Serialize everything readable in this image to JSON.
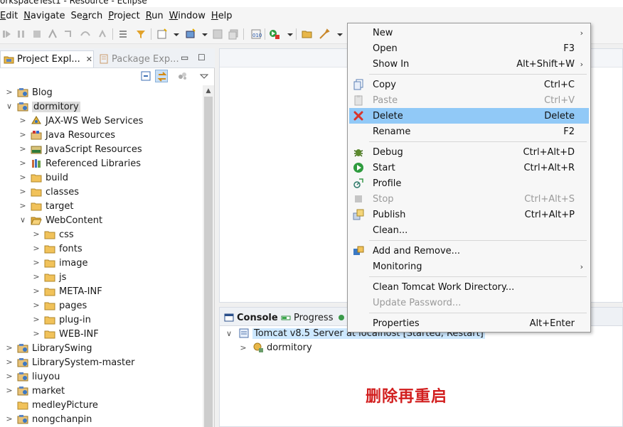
{
  "window": {
    "title": "orkspaceTest1 - Resource - Eclipse"
  },
  "menubar": [
    {
      "label": "Edit",
      "mnemonic": "E"
    },
    {
      "label": "Navigate",
      "mnemonic": "N"
    },
    {
      "label": "Search",
      "mnemonic": "a"
    },
    {
      "label": "Project",
      "mnemonic": "P"
    },
    {
      "label": "Run",
      "mnemonic": "R"
    },
    {
      "label": "Window",
      "mnemonic": "W"
    },
    {
      "label": "Help",
      "mnemonic": "H"
    }
  ],
  "left_tabs": {
    "project_explorer": {
      "label": "Project Expl...",
      "close": "✕"
    },
    "package_explorer": {
      "label": "Package Exp..."
    },
    "minimize": "▭",
    "maximize": "☐"
  },
  "tree": [
    {
      "label": "Blog",
      "icon": "project-icon",
      "expanded": false
    },
    {
      "label": "dormitory",
      "icon": "project-icon",
      "expanded": true,
      "selected": true
    },
    {
      "label": "JAX-WS Web Services",
      "icon": "webservice-icon",
      "expanded": false
    },
    {
      "label": "Java Resources",
      "icon": "java-resources-icon",
      "expanded": false
    },
    {
      "label": "JavaScript Resources",
      "icon": "js-resources-icon",
      "expanded": false
    },
    {
      "label": "Referenced Libraries",
      "icon": "library-icon",
      "expanded": false
    },
    {
      "label": "build",
      "icon": "folder-icon",
      "expanded": false
    },
    {
      "label": "classes",
      "icon": "folder-icon",
      "expanded": false
    },
    {
      "label": "target",
      "icon": "folder-icon",
      "expanded": false
    },
    {
      "label": "WebContent",
      "icon": "folder-open-icon",
      "expanded": true
    },
    {
      "label": "css",
      "icon": "folder-icon",
      "expanded": false
    },
    {
      "label": "fonts",
      "icon": "folder-icon",
      "expanded": false
    },
    {
      "label": "image",
      "icon": "folder-icon",
      "expanded": false
    },
    {
      "label": "js",
      "icon": "folder-icon",
      "expanded": false
    },
    {
      "label": "META-INF",
      "icon": "folder-icon",
      "expanded": false
    },
    {
      "label": "pages",
      "icon": "folder-icon",
      "expanded": false
    },
    {
      "label": "plug-in",
      "icon": "folder-icon",
      "expanded": false
    },
    {
      "label": "WEB-INF",
      "icon": "folder-icon",
      "expanded": false
    },
    {
      "label": "LibrarySwing",
      "icon": "project-icon",
      "expanded": false
    },
    {
      "label": "LibrarySystem-master",
      "icon": "project-icon",
      "expanded": false
    },
    {
      "label": "liuyou",
      "icon": "project-icon",
      "expanded": false
    },
    {
      "label": "market",
      "icon": "project-icon",
      "expanded": false
    },
    {
      "label": "medleyPicture",
      "icon": "folder-icon",
      "expanded": null
    },
    {
      "label": "nongchanpin",
      "icon": "project-icon",
      "expanded": false
    }
  ],
  "console": {
    "tabs": [
      {
        "label": "Console",
        "icon": "console-icon"
      },
      {
        "label": "Progress",
        "icon": "progress-icon"
      }
    ],
    "server": {
      "label": "Tomcat v8.5 Server at localhost  [Started, Restart]"
    },
    "module": {
      "label": "dormitory"
    }
  },
  "annotation": "删除再重启",
  "context_menu": {
    "items": [
      {
        "label": "New",
        "shortcut": "",
        "submenu": true,
        "icon": "",
        "disabled": false
      },
      {
        "label": "Open",
        "shortcut": "F3",
        "submenu": false,
        "icon": "",
        "disabled": false
      },
      {
        "label": "Show In",
        "shortcut": "Alt+Shift+W",
        "submenu": true,
        "icon": "",
        "disabled": false
      },
      {
        "label": "Copy",
        "shortcut": "Ctrl+C",
        "submenu": false,
        "icon": "copy-icon",
        "disabled": false
      },
      {
        "label": "Paste",
        "shortcut": "Ctrl+V",
        "submenu": false,
        "icon": "paste-icon",
        "disabled": true
      },
      {
        "label": "Delete",
        "shortcut": "Delete",
        "submenu": false,
        "icon": "delete-icon",
        "disabled": false,
        "hover": true
      },
      {
        "label": "Rename",
        "shortcut": "F2",
        "submenu": false,
        "icon": "",
        "disabled": false
      },
      {
        "label": "Debug",
        "shortcut": "Ctrl+Alt+D",
        "submenu": false,
        "icon": "debug-icon",
        "disabled": false
      },
      {
        "label": "Start",
        "shortcut": "Ctrl+Alt+R",
        "submenu": false,
        "icon": "start-icon",
        "disabled": false
      },
      {
        "label": "Profile",
        "shortcut": "",
        "submenu": false,
        "icon": "profile-icon",
        "disabled": false
      },
      {
        "label": "Stop",
        "shortcut": "Ctrl+Alt+S",
        "submenu": false,
        "icon": "stop-icon",
        "disabled": true
      },
      {
        "label": "Publish",
        "shortcut": "Ctrl+Alt+P",
        "submenu": false,
        "icon": "publish-icon",
        "disabled": false
      },
      {
        "label": "Clean...",
        "shortcut": "",
        "submenu": false,
        "icon": "",
        "disabled": false
      },
      {
        "label": "Add and Remove...",
        "shortcut": "",
        "submenu": false,
        "icon": "add-remove-icon",
        "disabled": false
      },
      {
        "label": "Monitoring",
        "shortcut": "",
        "submenu": true,
        "icon": "",
        "disabled": false
      },
      {
        "label": "Clean Tomcat Work Directory...",
        "shortcut": "",
        "submenu": false,
        "icon": "",
        "disabled": false
      },
      {
        "label": "Update Password...",
        "shortcut": "",
        "submenu": false,
        "icon": "",
        "disabled": true
      },
      {
        "label": "Properties",
        "shortcut": "Alt+Enter",
        "submenu": false,
        "icon": "",
        "disabled": false
      }
    ]
  },
  "colors": {
    "hover": "#91c9f7",
    "annotation": "#d21f1f",
    "delete": "#d9342b",
    "start": "#2e9b3e"
  }
}
